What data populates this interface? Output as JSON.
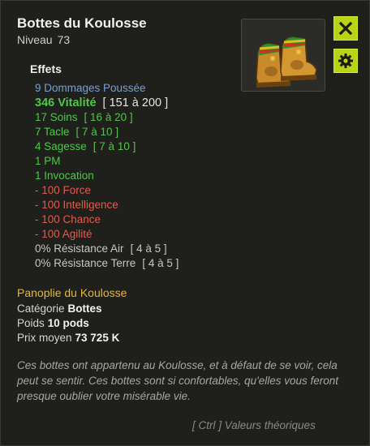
{
  "item": {
    "name": "Bottes du Koulosse",
    "level_label": "Niveau",
    "level_value": "73"
  },
  "icons": {
    "close": "close-icon",
    "settings": "gear-icon",
    "item": "boots-icon"
  },
  "effects_title": "Effets",
  "effects": [
    {
      "text": "9 Dommages Poussée",
      "range": "",
      "color": "#7a9fcf"
    },
    {
      "text": "346 Vitalité",
      "range": "[ 151 à 200 ]",
      "color": "#4fc74a"
    },
    {
      "text": "17 Soins",
      "range": "[ 16 à 20 ]",
      "color": "#4fc74a"
    },
    {
      "text": "7 Tacle",
      "range": "[ 7 à 10 ]",
      "color": "#4fc74a"
    },
    {
      "text": "4 Sagesse",
      "range": "[ 7 à 10 ]",
      "color": "#4fc74a"
    },
    {
      "text": "1 PM",
      "range": "",
      "color": "#4fc74a"
    },
    {
      "text": "1 Invocation",
      "range": "",
      "color": "#4fc74a"
    },
    {
      "text": "- 100 Force",
      "range": "",
      "color": "#e85a4a"
    },
    {
      "text": "- 100 Intelligence",
      "range": "",
      "color": "#e85a4a"
    },
    {
      "text": "- 100 Chance",
      "range": "",
      "color": "#e85a4a"
    },
    {
      "text": "- 100 Agilité",
      "range": "",
      "color": "#e85a4a"
    },
    {
      "text": "0% Résistance Air",
      "range": "[ 4 à 5 ]",
      "color": "#c8c8c0"
    },
    {
      "text": "0% Résistance Terre",
      "range": "[ 4 à 5 ]",
      "color": "#c8c8c0"
    }
  ],
  "set_name": "Panoplie du Koulosse",
  "info": {
    "category_label": "Catégorie",
    "category_value": "Bottes",
    "weight_label": "Poids",
    "weight_value": "10 pods",
    "price_label": "Prix moyen",
    "price_value": "73 725 K"
  },
  "description": "Ces bottes ont appartenu au Koulosse, et à défaut de se voir, cela peut se sentir. Ces bottes sont si confortables, qu'elles vous feront presque oublier votre misérable vie.",
  "footer": "[ Ctrl ] Valeurs théoriques"
}
